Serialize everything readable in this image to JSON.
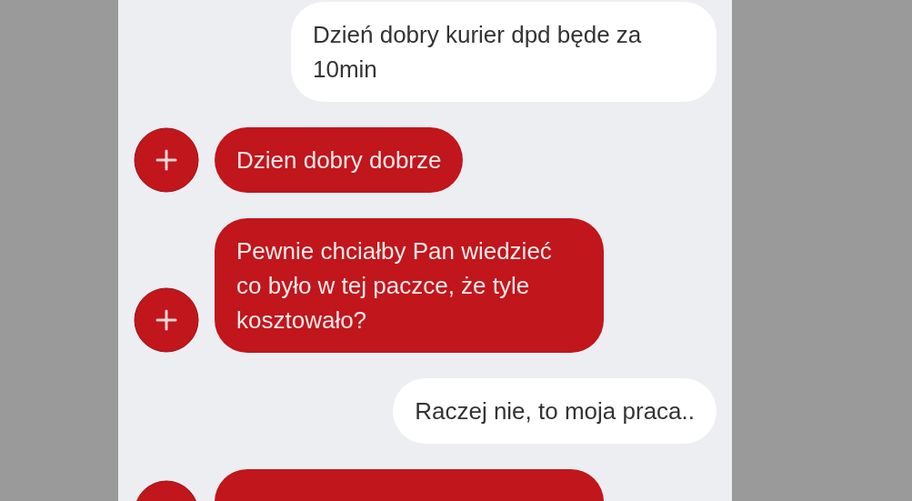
{
  "messages": [
    {
      "kind": "outgoing",
      "text": "Dzień dobry kurier dpd będe za 10min"
    },
    {
      "kind": "incoming",
      "text": "Dzien dobry dobrze"
    },
    {
      "kind": "incoming",
      "text": "Pewnie chciałby Pan wiedzieć co było w tej paczce, że tyle kosztowało?"
    },
    {
      "kind": "outgoing",
      "text": "Raczej nie, to moja praca.."
    },
    {
      "kind": "incoming"
    }
  ]
}
